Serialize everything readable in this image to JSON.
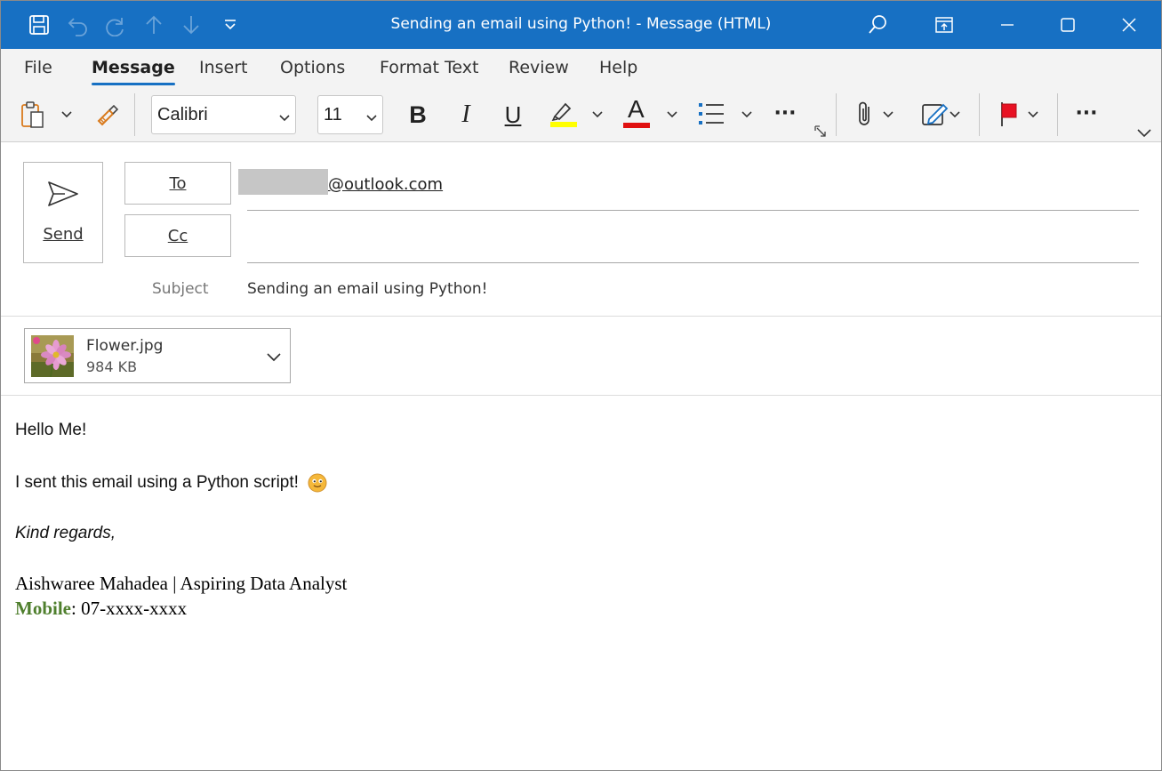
{
  "window": {
    "title": "Sending an email using Python!  -  Message (HTML)"
  },
  "quick_access": {
    "icons": [
      "save-icon",
      "undo-icon",
      "redo-icon",
      "up-arrow-icon",
      "down-arrow-icon",
      "customize-icon"
    ]
  },
  "window_controls": [
    "search-icon",
    "restore-ribbon-icon",
    "minimize-icon",
    "maximize-icon",
    "close-icon"
  ],
  "menu": {
    "tabs": [
      {
        "label": "File"
      },
      {
        "label": "Message"
      },
      {
        "label": "Insert"
      },
      {
        "label": "Options"
      },
      {
        "label": "Format Text"
      },
      {
        "label": "Review"
      },
      {
        "label": "Help"
      }
    ],
    "active": "Message"
  },
  "ribbon": {
    "font_name": "Calibri",
    "font_size": "11",
    "bold": "B",
    "italic": "I",
    "underline": "U",
    "font_color_glyph": "A",
    "more": "···",
    "highlight_color": "#ffff00",
    "font_color": "#e01010"
  },
  "compose": {
    "send_label": "Send",
    "to_label": "To",
    "cc_label": "Cc",
    "to_value": "@outlook.com",
    "cc_value": "",
    "subject_label": "Subject",
    "subject_value": "Sending an email using Python!"
  },
  "attachment": {
    "name": "Flower.jpg",
    "size": "984 KB"
  },
  "body": {
    "greeting": "Hello Me!",
    "line1": "I sent this email using a Python script!",
    "closing": "Kind regards,",
    "signature": "Aishwaree Mahadea | Aspiring Data Analyst",
    "mobile_label": "Mobile",
    "mobile_value": ": 07-xxxx-xxxx"
  },
  "colors": {
    "titlebar": "#1770c3",
    "accent": "#1770c3",
    "mobile_label": "#4f7f2d",
    "flag": "#e81123"
  }
}
